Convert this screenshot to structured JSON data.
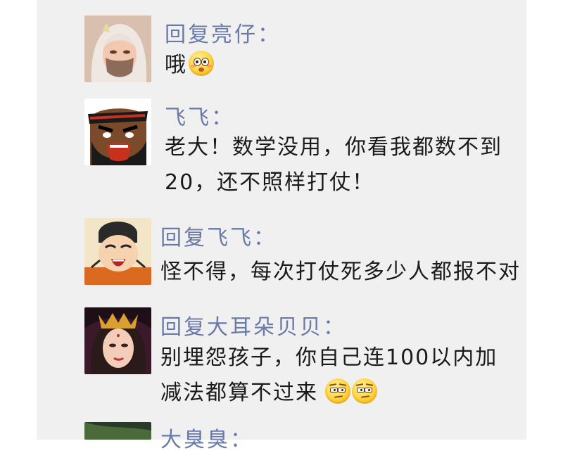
{
  "comments": [
    {
      "name": "回复亮仔：",
      "text_lines": [
        "哦"
      ],
      "emoji": [
        "flushed-face"
      ],
      "avatar": "girl-avatar"
    },
    {
      "name": "飞飞：",
      "text_lines": [
        "老大！数学没用，你看我都数不到",
        " 20，还不照样打仗！"
      ],
      "emoji": [],
      "avatar": "zhangfei-avatar"
    },
    {
      "name": "回复飞飞：",
      "text_lines": [
        "怪不得，每次打仗死多少人都报不对"
      ],
      "emoji": [],
      "avatar": "liubei-avatar"
    },
    {
      "name": "回复大耳朵贝贝：",
      "text_lines": [
        "别埋怨孩子，你自己连100以内加",
        "减法都算不过来"
      ],
      "emoji": [
        "sly-face",
        "sly-face"
      ],
      "avatar": "lady-avatar"
    },
    {
      "name": "大臭臭：",
      "text_lines": [],
      "emoji": [],
      "avatar": "green-avatar"
    }
  ],
  "colors": {
    "name": "#6a7aa8",
    "text": "#1a1a1a",
    "panel": "#f0f0f0"
  }
}
